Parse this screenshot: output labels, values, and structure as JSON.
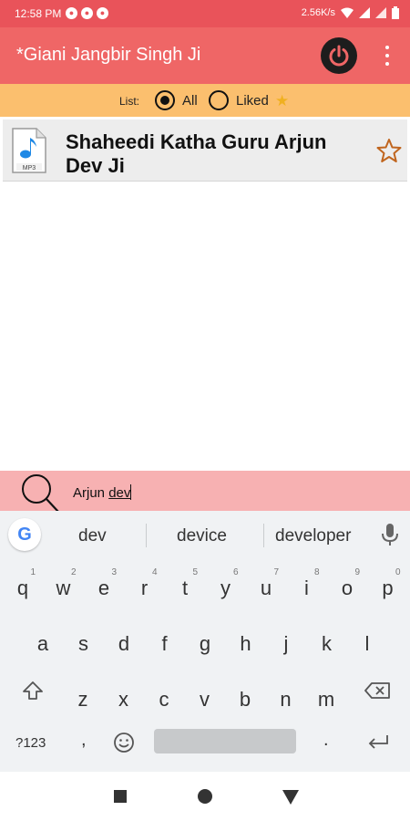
{
  "status_bar": {
    "time": "12:58 PM",
    "net_speed": "2.56K/s"
  },
  "app_bar": {
    "title": "*Giani Jangbir Singh Ji",
    "power_icon": "power-icon",
    "menu_icon": "more-vert-icon",
    "color": "#ef6666"
  },
  "filter": {
    "label": "List:",
    "options": [
      {
        "label": "All",
        "selected": true
      },
      {
        "label": "Liked",
        "selected": false
      }
    ],
    "color": "#fbbf6e"
  },
  "list": {
    "items": [
      {
        "title": "Shaheedi Katha Guru Arjun Dev Ji",
        "icon": "mp3-file-icon",
        "favorite": false
      }
    ]
  },
  "search": {
    "query_prefix": "Arjun ",
    "query_composing": "dev",
    "color": "#f7b1b2"
  },
  "keyboard": {
    "suggestions": [
      "dev",
      "device",
      "developer"
    ],
    "google_logo": "G",
    "row1": [
      {
        "c": "q",
        "n": "1"
      },
      {
        "c": "w",
        "n": "2"
      },
      {
        "c": "e",
        "n": "3"
      },
      {
        "c": "r",
        "n": "4"
      },
      {
        "c": "t",
        "n": "5"
      },
      {
        "c": "y",
        "n": "6"
      },
      {
        "c": "u",
        "n": "7"
      },
      {
        "c": "i",
        "n": "8"
      },
      {
        "c": "o",
        "n": "9"
      },
      {
        "c": "p",
        "n": "0"
      }
    ],
    "row2": [
      "a",
      "s",
      "d",
      "f",
      "g",
      "h",
      "j",
      "k",
      "l"
    ],
    "row3": [
      "z",
      "x",
      "c",
      "v",
      "b",
      "n",
      "m"
    ],
    "symbols_label": "?123",
    "comma": ",",
    "period": ".",
    "emoji_icon": "emoji-icon",
    "shift_icon": "shift-icon",
    "backspace_icon": "backspace-icon",
    "enter_icon": "enter-icon"
  },
  "nav_bar": {
    "buttons": [
      "recents-icon",
      "home-icon",
      "back-icon"
    ]
  }
}
